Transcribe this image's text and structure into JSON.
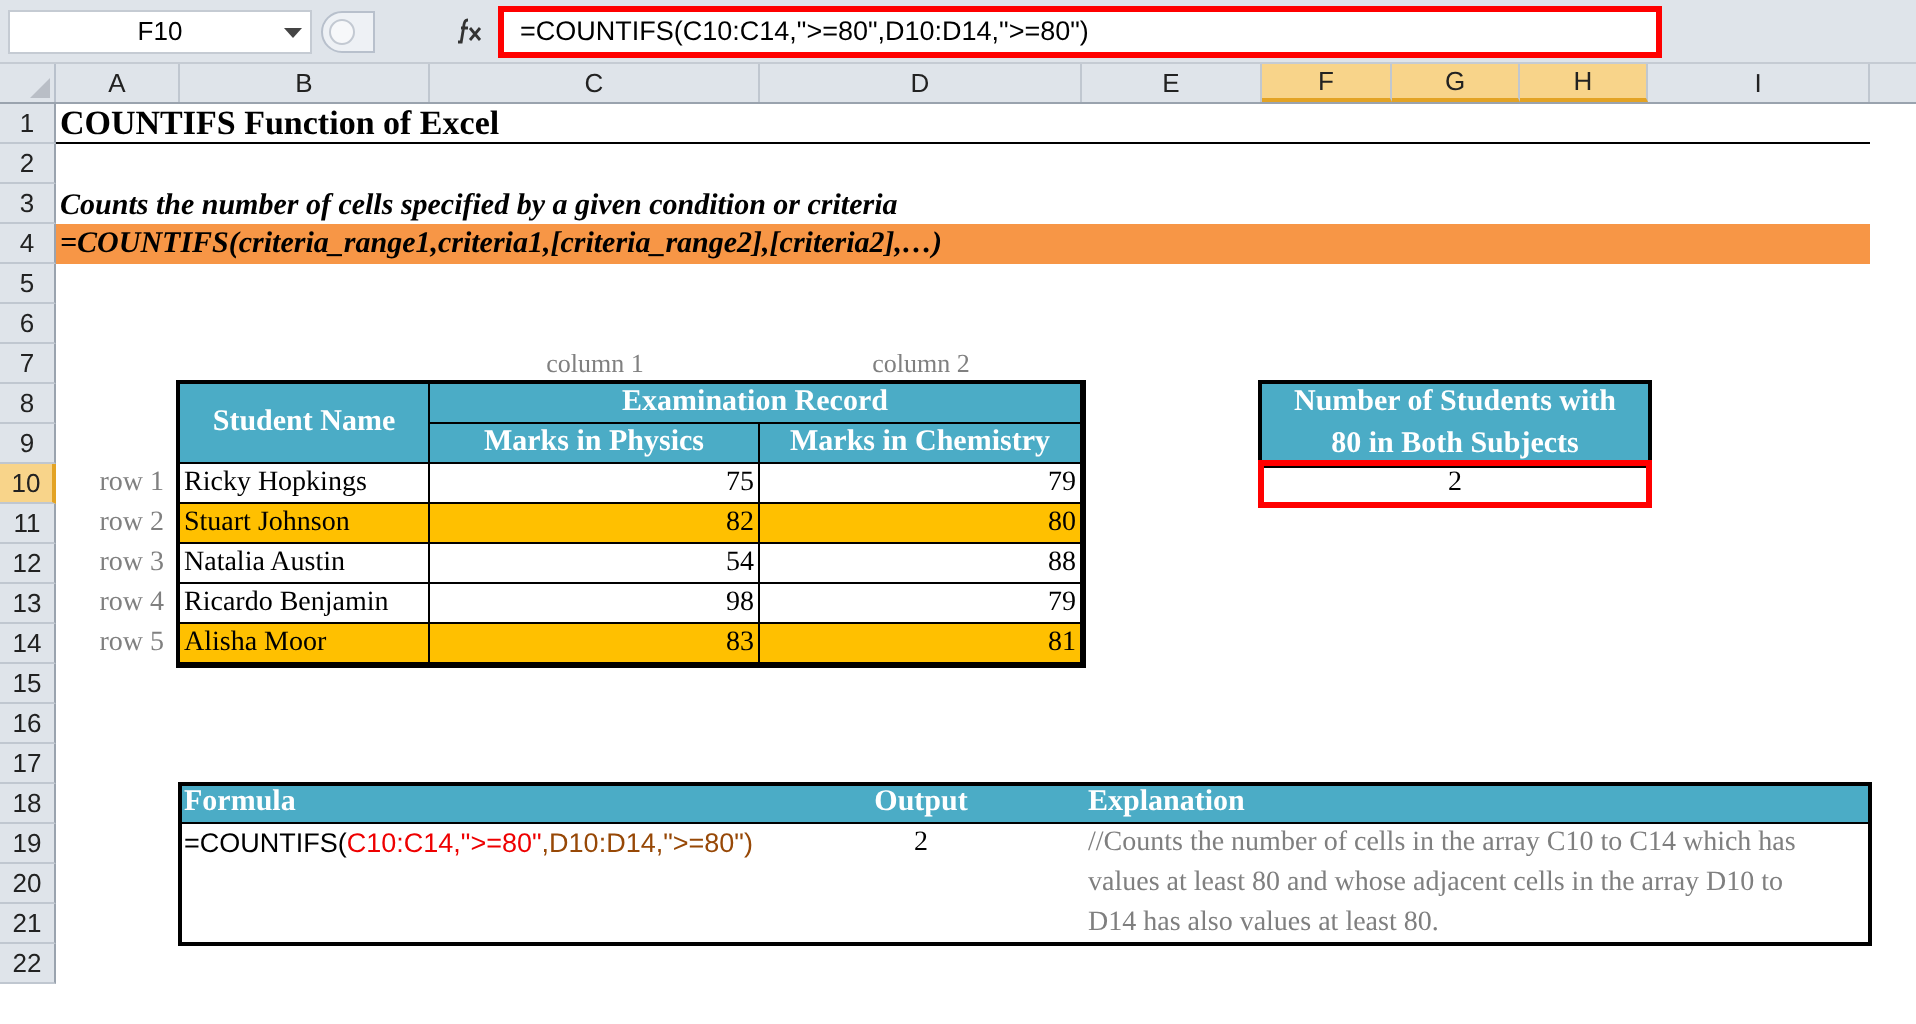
{
  "name_box": "F10",
  "formula_bar": {
    "value": "=COUNTIFS(C10:C14,\">=80\",D10:D14,\">=80\")",
    "highlighted": true
  },
  "column_headers": [
    {
      "label": "A",
      "selected": false
    },
    {
      "label": "B",
      "selected": false
    },
    {
      "label": "C",
      "selected": false
    },
    {
      "label": "D",
      "selected": false
    },
    {
      "label": "E",
      "selected": false
    },
    {
      "label": "F",
      "selected": true
    },
    {
      "label": "G",
      "selected": true
    },
    {
      "label": "H",
      "selected": true
    },
    {
      "label": "I",
      "selected": false
    }
  ],
  "row_headers": [
    {
      "label": "1",
      "selected": false
    },
    {
      "label": "2",
      "selected": false
    },
    {
      "label": "3",
      "selected": false
    },
    {
      "label": "4",
      "selected": false
    },
    {
      "label": "5",
      "selected": false
    },
    {
      "label": "6",
      "selected": false
    },
    {
      "label": "7",
      "selected": false
    },
    {
      "label": "8",
      "selected": false
    },
    {
      "label": "9",
      "selected": false
    },
    {
      "label": "10",
      "selected": true
    },
    {
      "label": "11",
      "selected": false
    },
    {
      "label": "12",
      "selected": false
    },
    {
      "label": "13",
      "selected": false
    },
    {
      "label": "14",
      "selected": false
    },
    {
      "label": "15",
      "selected": false
    },
    {
      "label": "16",
      "selected": false
    },
    {
      "label": "17",
      "selected": false
    },
    {
      "label": "18",
      "selected": false
    },
    {
      "label": "19",
      "selected": false
    },
    {
      "label": "20",
      "selected": false
    },
    {
      "label": "21",
      "selected": false
    },
    {
      "label": "22",
      "selected": false
    }
  ],
  "title": "COUNTIFS Function of Excel",
  "description": "Counts the number of cells specified by a given condition or criteria",
  "syntax": "=COUNTIFS(criteria_range1,criteria1,[criteria_range2],[criteria2],…)",
  "column_labels": [
    "column 1",
    "column 2"
  ],
  "row_labels": [
    "row 1",
    "row 2",
    "row 3",
    "row 4",
    "row 5"
  ],
  "records_table": {
    "name_header": "Student Name",
    "group_header": "Examination Record",
    "columns": [
      "Marks in Physics",
      "Marks in Chemistry"
    ],
    "rows": [
      {
        "name": "Ricky Hopkings",
        "physics": "75",
        "chemistry": "79",
        "highlighted": false
      },
      {
        "name": "Stuart Johnson",
        "physics": "82",
        "chemistry": "80",
        "highlighted": true
      },
      {
        "name": "Natalia Austin",
        "physics": "54",
        "chemistry": "88",
        "highlighted": false
      },
      {
        "name": "Ricardo Benjamin",
        "physics": "98",
        "chemistry": "79",
        "highlighted": false
      },
      {
        "name": "Alisha Moor",
        "physics": "83",
        "chemistry": "81",
        "highlighted": true
      }
    ]
  },
  "result": {
    "header": "Number of Students with 80 in Both Subjects",
    "value": "2",
    "highlighted": true
  },
  "formula_table": {
    "columns": [
      "Formula",
      "Output",
      "Explanation"
    ],
    "formula_parts": [
      {
        "kind": "function",
        "text": "=COUNTIFS("
      },
      {
        "kind": "range1",
        "text": "C10:C14,\">=80\""
      },
      {
        "kind": "range2",
        "text": ",D10:D14,\">=80\")"
      }
    ],
    "output": "2",
    "explanation": "//Counts the number of cells in the array C10 to C14 which has values at least 80 and whose adjacent cells in the array D10 to D14 has also values at least 80."
  }
}
